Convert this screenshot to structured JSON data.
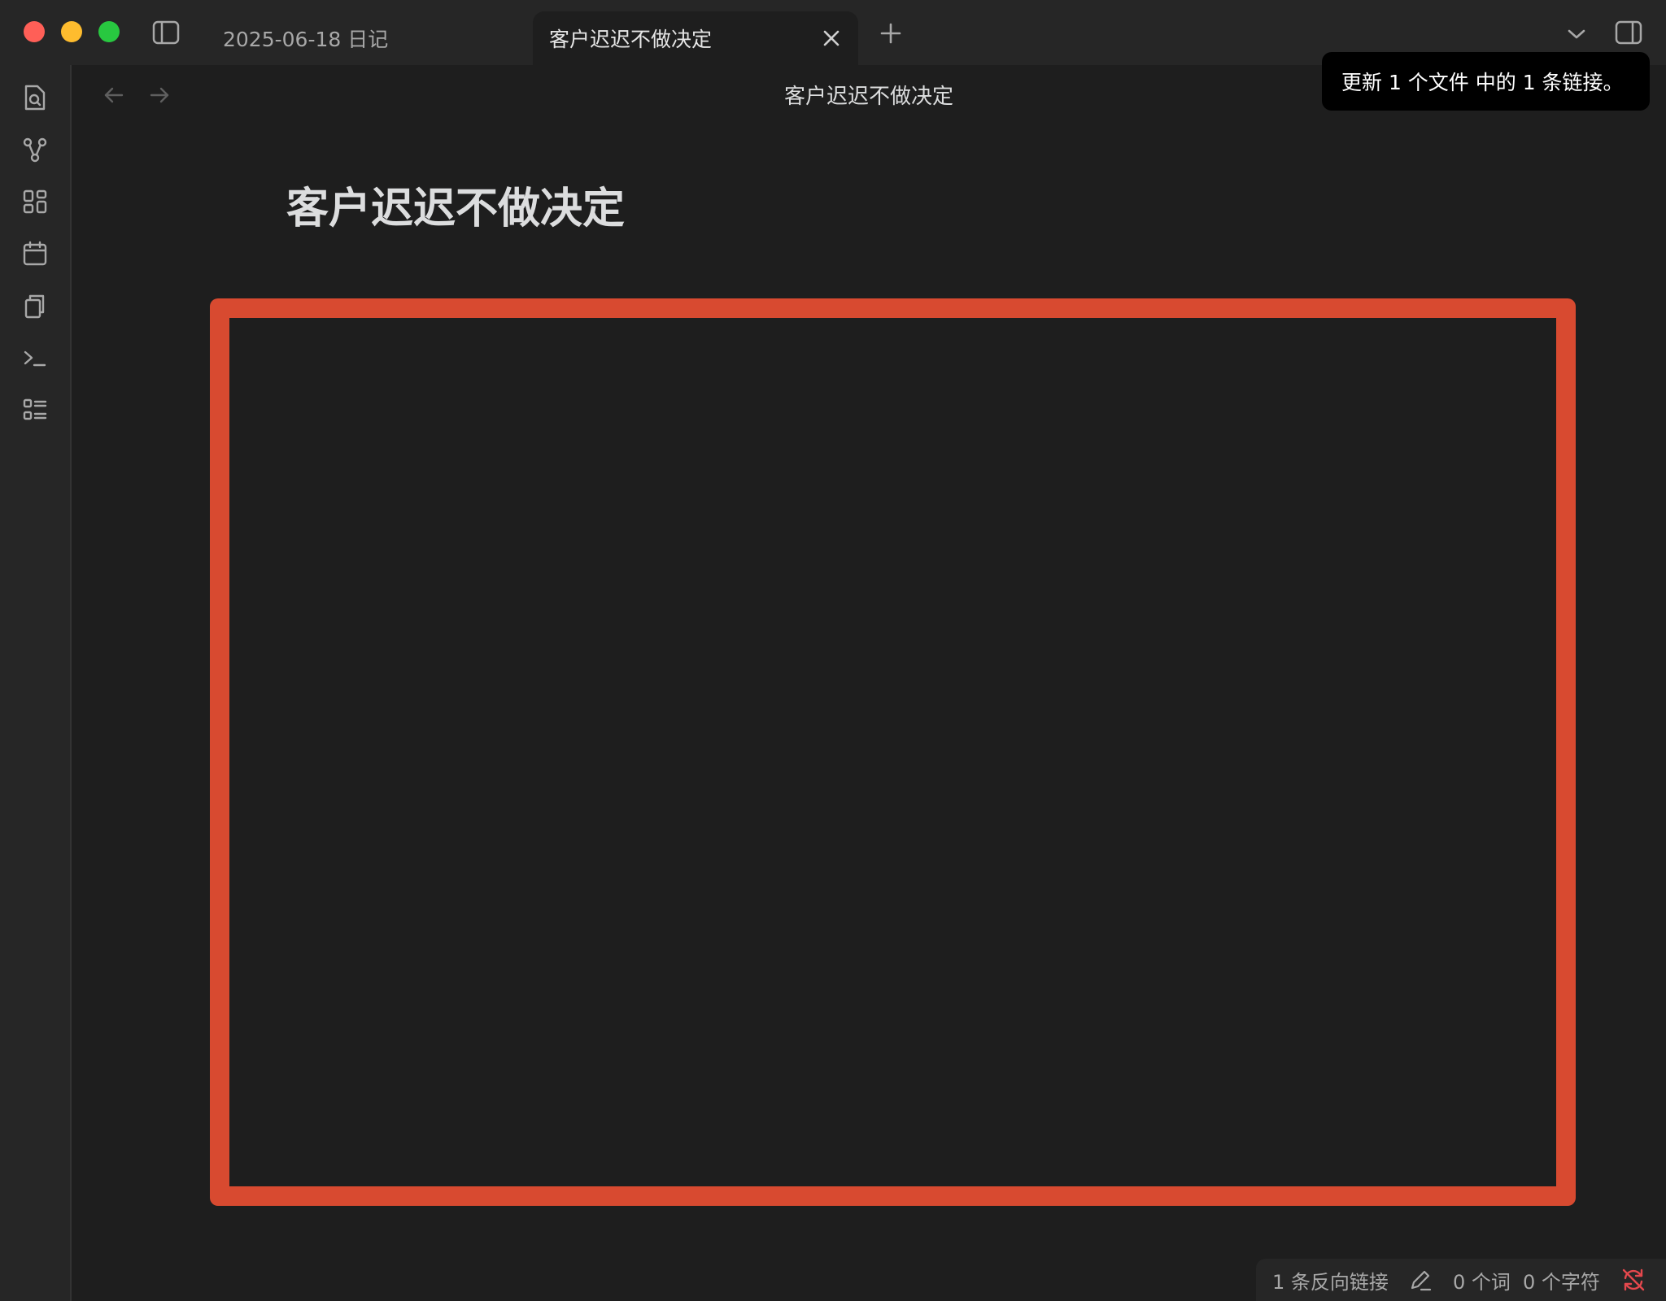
{
  "window": {
    "tabs": [
      {
        "label": "2025-06-18 日记",
        "active": false
      },
      {
        "label": "客户迟迟不做决定",
        "active": true
      }
    ]
  },
  "ribbon": {
    "icons": [
      "search-file-icon",
      "graph-icon",
      "layout-grid-icon",
      "calendar-icon",
      "copy-icon",
      "terminal-icon",
      "list-icon"
    ]
  },
  "view": {
    "title": "客户迟迟不做决定"
  },
  "notice": {
    "text": "更新 1 个文件 中的 1 条链接。"
  },
  "note": {
    "title": "客户迟迟不做决定",
    "embed_border_color": "#d84a30"
  },
  "statusbar": {
    "backlinks": "1 条反向链接",
    "words": "0 个词",
    "chars": "0 个字符"
  },
  "colors": {
    "background": "#1e1e1e",
    "panel": "#262626",
    "accent_red": "#d84a30",
    "sync_error": "#e5484d"
  }
}
